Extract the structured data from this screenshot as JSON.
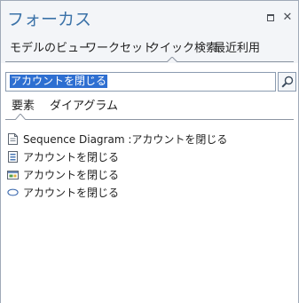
{
  "panel": {
    "title": "フォーカス"
  },
  "tabs": [
    {
      "label": "モデルのビュー"
    },
    {
      "label": "ワークセット"
    },
    {
      "label": "クイック検索"
    },
    {
      "label": "最近利用"
    }
  ],
  "active_tab": "クイック検索",
  "search": {
    "value": "アカウントを閉じる"
  },
  "subtabs": [
    {
      "label": "要素"
    },
    {
      "label": "ダイアグラム"
    }
  ],
  "active_subtab": "要素",
  "results": [
    {
      "icon": "sequence-diagram-icon",
      "label": "Sequence Diagram :アカウントを閉じる"
    },
    {
      "icon": "requirement-element-icon",
      "label": "アカウントを閉じる"
    },
    {
      "icon": "screen-element-icon",
      "label": "アカウントを閉じる"
    },
    {
      "icon": "use-case-icon",
      "label": "アカウントを閉じる"
    }
  ],
  "colors": {
    "title": "#3b72a8",
    "selection": "#2e6fd1",
    "border": "#a0aab8"
  }
}
